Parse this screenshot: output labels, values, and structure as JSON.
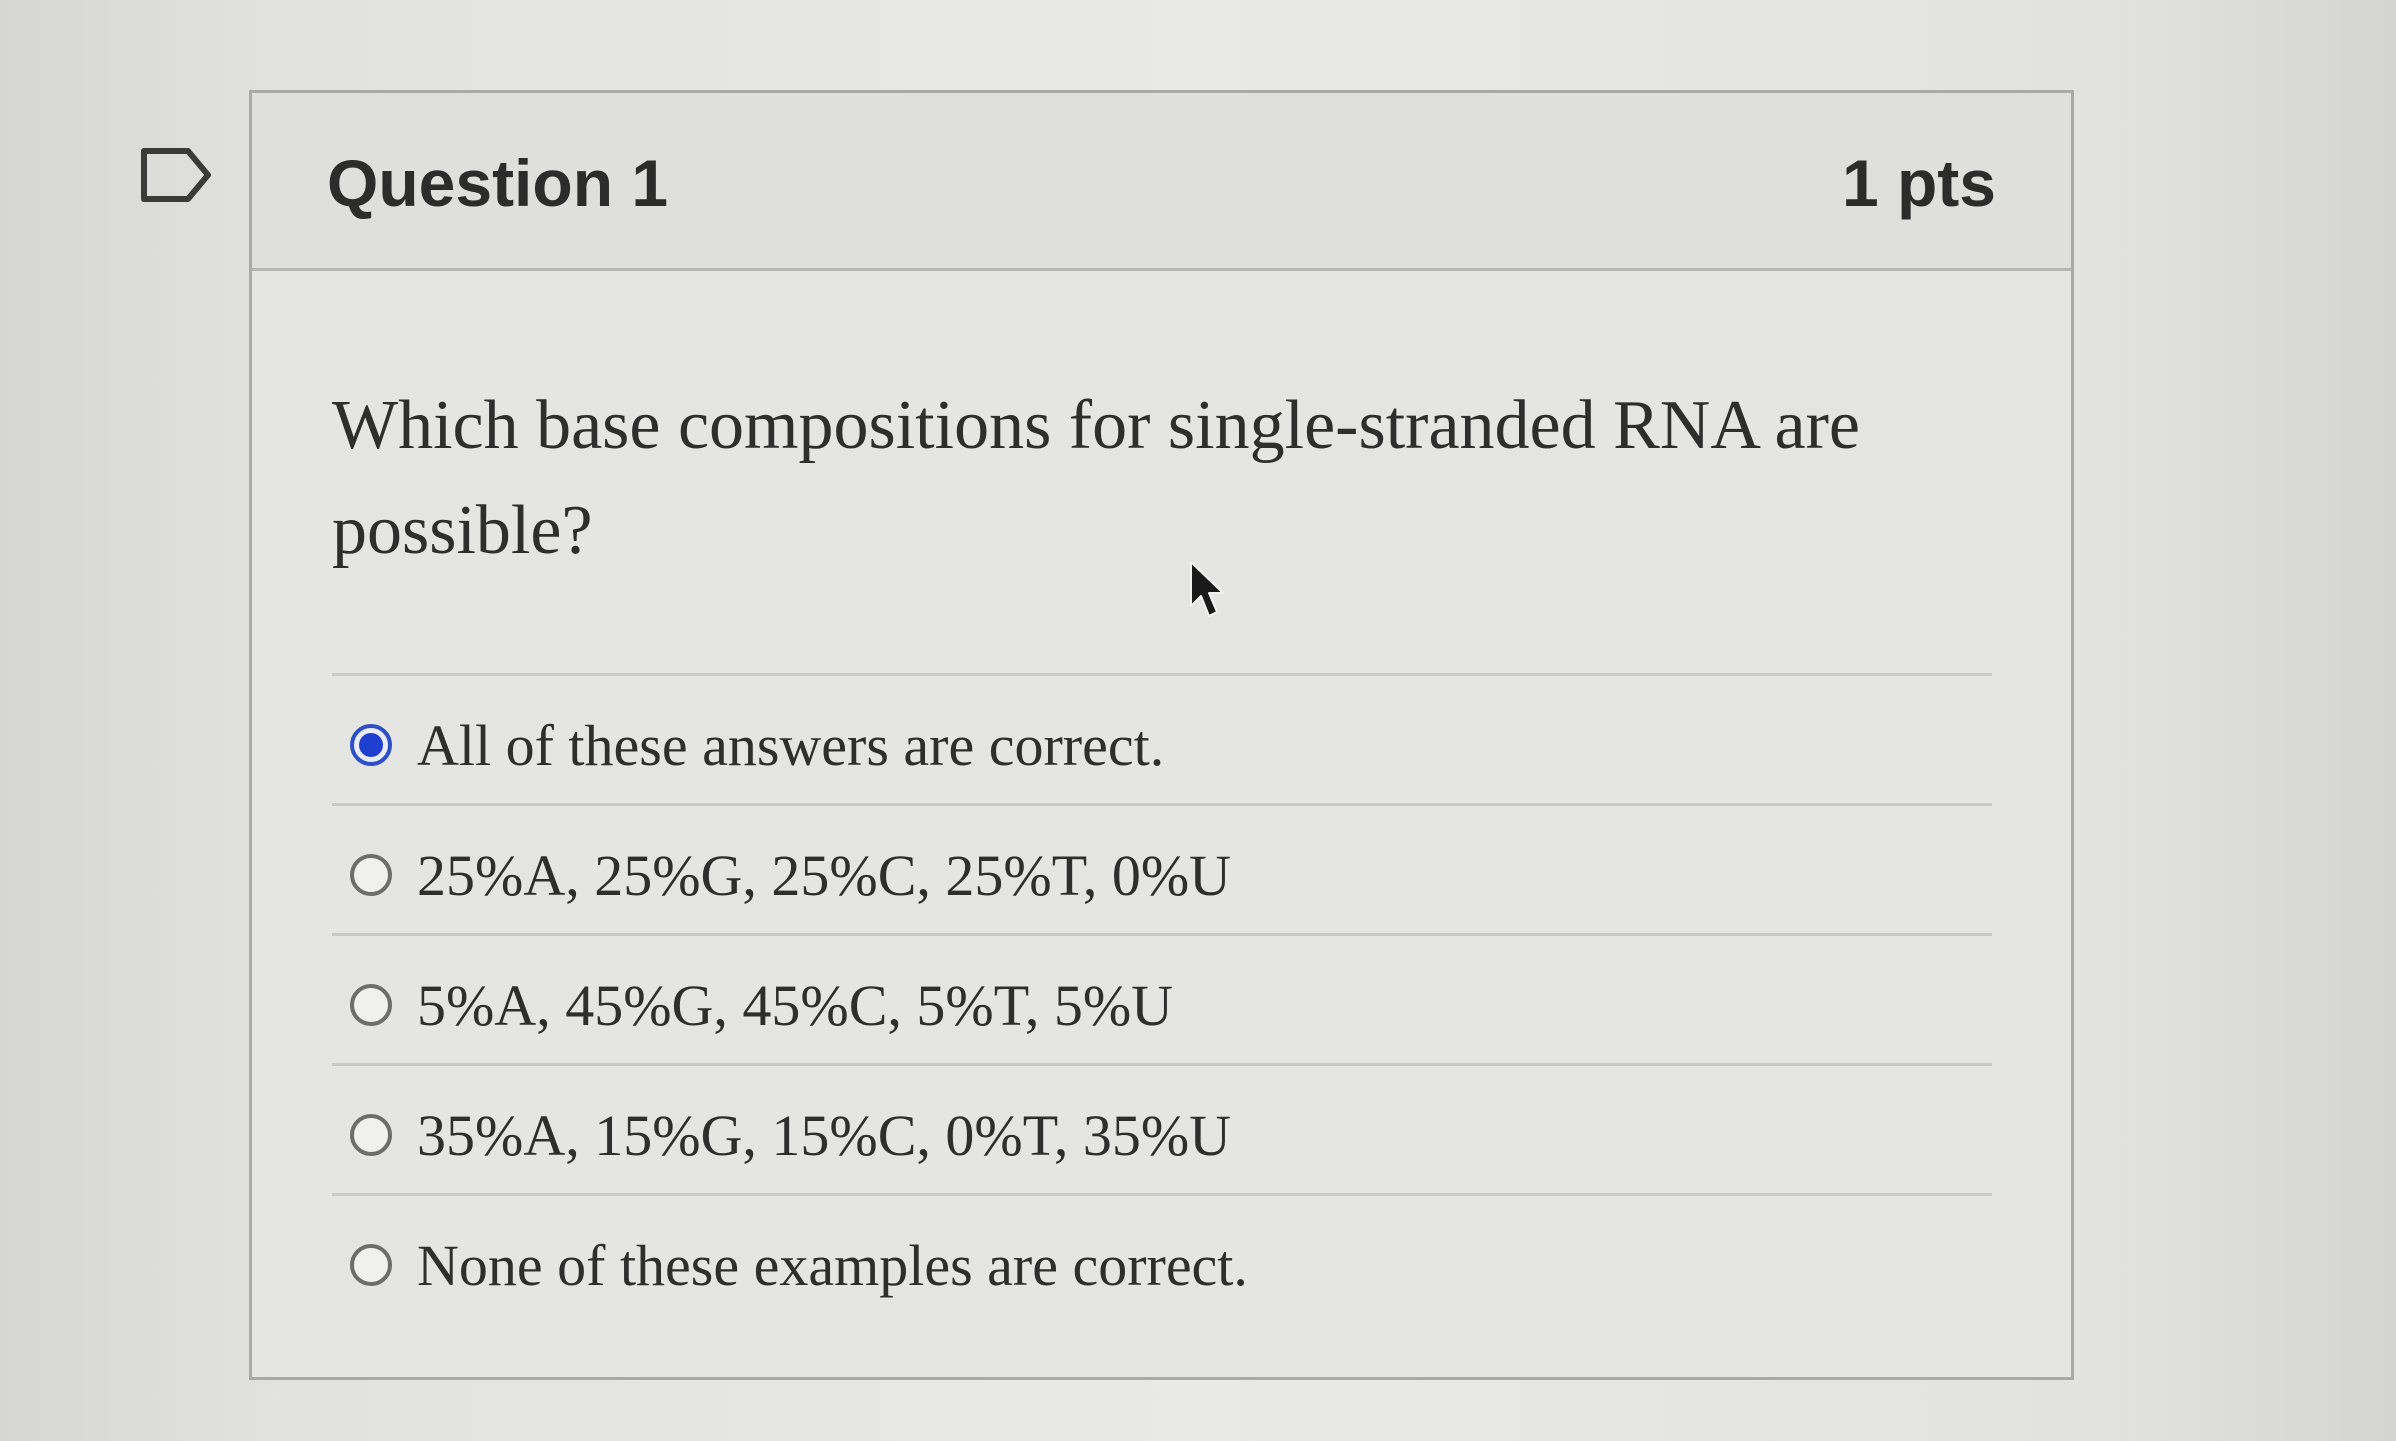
{
  "question": {
    "title": "Question 1",
    "points": "1 pts",
    "text": "Which base compositions for single-stranded RNA are possible?",
    "flag_icon": "bookmark-flag-icon"
  },
  "answers": [
    {
      "label": "All of these answers are correct.",
      "selected": true
    },
    {
      "label": "25%A, 25%G, 25%C, 25%T, 0%U",
      "selected": false
    },
    {
      "label": "5%A, 45%G, 45%C, 5%T, 5%U",
      "selected": false
    },
    {
      "label": "35%A, 15%G, 15%C, 0%T, 35%U",
      "selected": false
    },
    {
      "label": "None of these examples are correct.",
      "selected": false
    }
  ],
  "colors": {
    "selected_radio": "#1e3fd0",
    "header_bg": "#dfdfdd",
    "card_border": "#a9a9a7"
  }
}
